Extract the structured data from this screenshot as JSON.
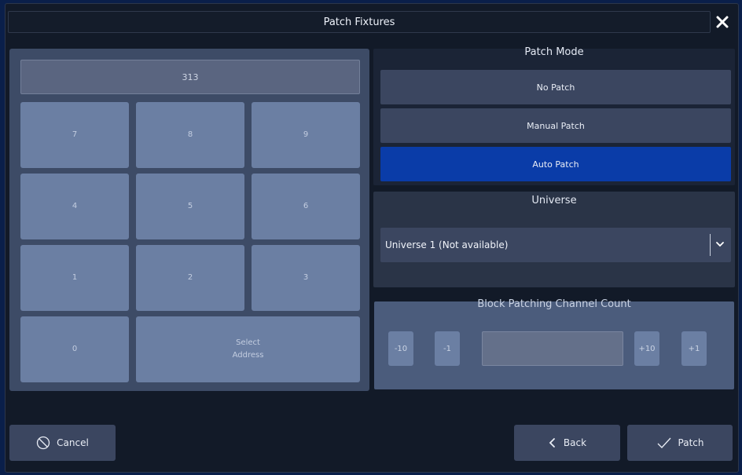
{
  "dialog": {
    "title": "Patch Fixtures",
    "close_icon": "close-icon"
  },
  "keypad": {
    "display_value": "313",
    "keys": [
      {
        "label": "7"
      },
      {
        "label": "8"
      },
      {
        "label": "9"
      },
      {
        "label": "4"
      },
      {
        "label": "5"
      },
      {
        "label": "6"
      },
      {
        "label": "1"
      },
      {
        "label": "2"
      },
      {
        "label": "3"
      },
      {
        "label": "0"
      }
    ],
    "select_address_line1": "Select",
    "select_address_line2": "Address"
  },
  "patch_mode": {
    "title": "Patch Mode",
    "options": [
      {
        "label": "No Patch",
        "active": false
      },
      {
        "label": "Manual Patch",
        "active": false
      },
      {
        "label": "Auto Patch",
        "active": true
      }
    ]
  },
  "universe": {
    "title": "Universe",
    "selected": "Universe 1 (Not available)"
  },
  "block_patching": {
    "title": "Block Patching Channel Count",
    "minus10": "-10",
    "minus1": "-1",
    "value": "",
    "plus10": "+10",
    "plus1": "+1"
  },
  "footer": {
    "cancel_label": "Cancel",
    "back_label": "Back",
    "patch_label": "Patch"
  },
  "colors": {
    "active_mode": "#0a3ca8",
    "keypad_bg": "#3d4b66",
    "key_bg": "#6b7fa3"
  }
}
